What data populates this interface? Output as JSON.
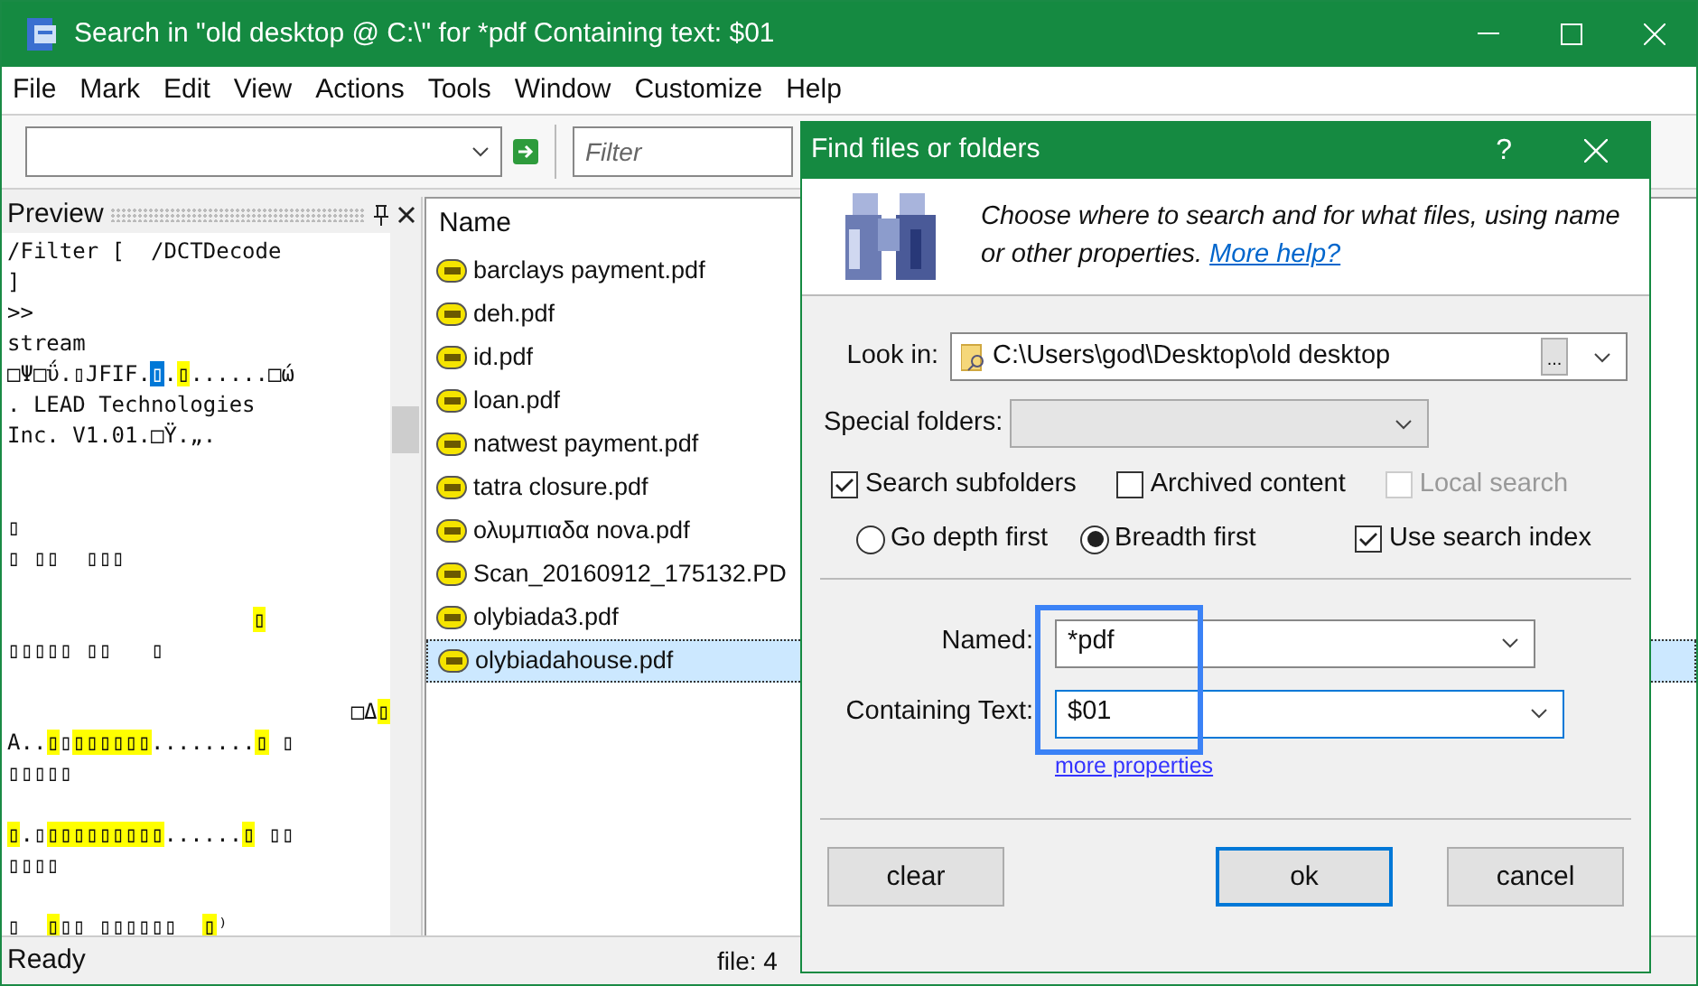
{
  "window": {
    "title": "Search in \"old desktop @ C:\\\" for *pdf Containing text: $01"
  },
  "menu": [
    "File",
    "Mark",
    "Edit",
    "View",
    "Actions",
    "Tools",
    "Window",
    "Customize",
    "Help"
  ],
  "toolbar": {
    "filter_placeholder": "Filter"
  },
  "preview": {
    "title": "Preview",
    "lines": [
      {
        "kind": "text",
        "segments": [
          {
            "text": "/Filter [  /DCTDecode",
            "kind": "plain"
          }
        ]
      },
      {
        "kind": "text",
        "segments": [
          {
            "text": "]",
            "kind": "plain"
          }
        ]
      },
      {
        "kind": "text",
        "segments": [
          {
            "text": ">>",
            "kind": "plain"
          }
        ]
      },
      {
        "kind": "text",
        "segments": [
          {
            "text": "stream",
            "kind": "plain"
          }
        ]
      },
      {
        "kind": "text",
        "segments": [
          {
            "text": "□Ψ□ΰ.▯JFIF.",
            "kind": "plain"
          },
          {
            "text": "▯",
            "kind": "selection"
          },
          {
            "text": ".",
            "kind": "plain"
          },
          {
            "text": "▯",
            "kind": "highlight"
          },
          {
            "text": "......□ώ",
            "kind": "plain"
          }
        ]
      },
      {
        "kind": "text",
        "segments": [
          {
            "text": ". LEAD Technologies",
            "kind": "plain"
          }
        ]
      },
      {
        "kind": "text",
        "segments": [
          {
            "text": "Inc. V1.01.□Ÿ.„.",
            "kind": "plain"
          }
        ]
      },
      {
        "kind": "blank"
      },
      {
        "kind": "blank"
      },
      {
        "kind": "text",
        "segments": [
          {
            "text": "▯",
            "kind": "plain"
          }
        ]
      },
      {
        "kind": "text",
        "segments": [
          {
            "text": "▯ ▯▯  ▯▯▯",
            "kind": "plain"
          }
        ]
      },
      {
        "kind": "blank"
      },
      {
        "kind": "indented",
        "segments": [
          {
            "text": "▯",
            "kind": "highlight"
          }
        ]
      },
      {
        "kind": "text",
        "segments": [
          {
            "text": "▯▯▯▯▯ ▯▯   ▯",
            "kind": "plain"
          }
        ]
      },
      {
        "kind": "blank"
      },
      {
        "kind": "right",
        "segments": [
          {
            "text": "□Δ",
            "kind": "plain"
          },
          {
            "text": "▯",
            "kind": "highlight"
          }
        ]
      },
      {
        "kind": "text",
        "segments": [
          {
            "text": "A..",
            "kind": "plain"
          },
          {
            "text": "▯",
            "kind": "highlight"
          },
          {
            "text": "▯",
            "kind": "plain"
          },
          {
            "text": "▯▯▯▯▯▯",
            "kind": "highlight"
          },
          {
            "text": "........",
            "kind": "plain"
          },
          {
            "text": "▯",
            "kind": "highlight"
          },
          {
            "text": " ▯",
            "kind": "plain"
          }
        ]
      },
      {
        "kind": "text",
        "segments": [
          {
            "text": "▯▯▯▯▯",
            "kind": "plain"
          }
        ]
      },
      {
        "kind": "blank"
      },
      {
        "kind": "text",
        "segments": [
          {
            "text": "▯",
            "kind": "highlight"
          },
          {
            "text": ".▯",
            "kind": "plain"
          },
          {
            "text": "▯▯▯▯▯▯▯▯▯",
            "kind": "highlight"
          },
          {
            "text": "......",
            "kind": "plain"
          },
          {
            "text": "▯",
            "kind": "highlight"
          },
          {
            "text": " ▯▯",
            "kind": "plain"
          }
        ]
      },
      {
        "kind": "text",
        "segments": [
          {
            "text": "▯▯▯▯",
            "kind": "plain"
          }
        ]
      },
      {
        "kind": "blank"
      },
      {
        "kind": "text",
        "segments": [
          {
            "text": "▯  ",
            "kind": "plain"
          },
          {
            "text": "▯",
            "kind": "highlight"
          },
          {
            "text": "▯▯ ▯▯▯▯▯▯  ",
            "kind": "plain"
          },
          {
            "text": "▯",
            "kind": "highlight"
          },
          {
            "text": "⁾",
            "kind": "plain"
          }
        ]
      }
    ]
  },
  "file_list": {
    "column": "Name",
    "rows": [
      {
        "name": "barclays payment.pdf",
        "selected": false
      },
      {
        "name": "deh.pdf",
        "selected": false
      },
      {
        "name": "id.pdf",
        "selected": false
      },
      {
        "name": "loan.pdf",
        "selected": false
      },
      {
        "name": "natwest payment.pdf",
        "selected": false
      },
      {
        "name": "tatra closure.pdf",
        "selected": false
      },
      {
        "name": "ολυμπιαδα nova.pdf",
        "selected": false
      },
      {
        "name": "Scan_20160912_175132.PD",
        "selected": false
      },
      {
        "name": "olybiada3.pdf",
        "selected": false
      },
      {
        "name": "olybiadahouse.pdf",
        "selected": true
      }
    ]
  },
  "status_bar": {
    "state": "Ready",
    "file": "file: 4"
  },
  "dialog": {
    "title": "Find files or folders",
    "help": "?",
    "intro": "Choose where to search and for what files, using name or other properties.",
    "help_link": "More help?",
    "look_in": {
      "label": "Look in:",
      "value": "C:\\Users\\god\\Desktop\\old desktop",
      "browse": "..."
    },
    "special_folders": {
      "label": "Special folders:",
      "disabled": true
    },
    "checkboxes": [
      {
        "label": "Search subfolders",
        "checked": true,
        "disabled": false
      },
      {
        "label": "Archived content",
        "checked": false,
        "disabled": false
      },
      {
        "label": "Local search",
        "checked": false,
        "disabled": true
      }
    ],
    "radios": [
      {
        "label": "Go depth first",
        "selected": false
      },
      {
        "label": "Breadth first",
        "selected": true
      }
    ],
    "use_index": {
      "label": "Use search index",
      "checked": true
    },
    "named": {
      "label": "Named:",
      "value": "*pdf",
      "focused": false
    },
    "containing": {
      "label": "Containing Text:",
      "value": "$01",
      "focused": true
    },
    "more_properties": "more properties",
    "buttons": [
      {
        "label": "clear",
        "default": false
      },
      {
        "label": "ok",
        "default": true
      },
      {
        "label": "cancel",
        "default": false
      }
    ]
  }
}
